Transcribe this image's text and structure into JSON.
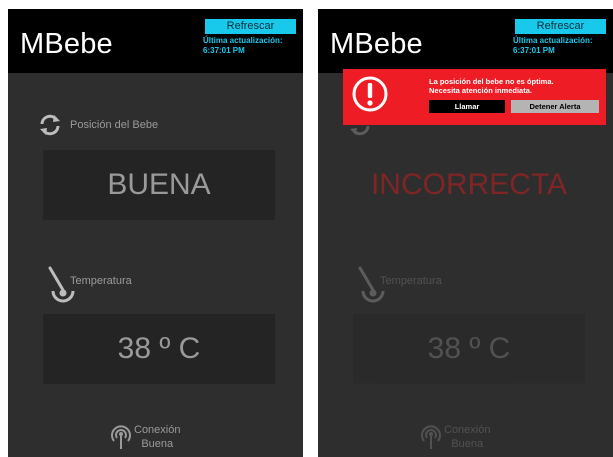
{
  "colors": {
    "accent": "#19c9ec",
    "alert": "#ee1c24",
    "warning_text": "#c21e1e",
    "background": "#2e2e2e",
    "topbar": "#000000"
  },
  "left_screen": {
    "app_title": "MBebe",
    "refresh_label": "Refrescar",
    "update_label": "Última actualización:",
    "update_time": "6:37:01 PM",
    "position_label": "Posición del Bebe",
    "position_icon": "refresh-arrows-icon",
    "position_value": "BUENA",
    "temperature_label": "Temperatura",
    "temperature_icon": "thermometer-icon",
    "temperature_value": "38 º C",
    "connection_icon": "antenna-icon",
    "connection_line1": "Conexión",
    "connection_line2": "Buena"
  },
  "right_screen": {
    "app_title": "MBebe",
    "refresh_label": "Refrescar",
    "update_label": "Última actualización:",
    "update_time": "6:37:01 PM",
    "position_value": "INCORRECTA",
    "temperature_label": "Temperatura",
    "temperature_value": "38 º C",
    "connection_line1": "Conexión",
    "connection_line2": "Buena",
    "alert": {
      "icon": "exclamation-circle-icon",
      "message_line1": "La posición del bebe no es óptima.",
      "message_line2": "Necesita atención inmediata.",
      "call_button": "Llamar",
      "stop_button": "Detener Alerta"
    }
  }
}
